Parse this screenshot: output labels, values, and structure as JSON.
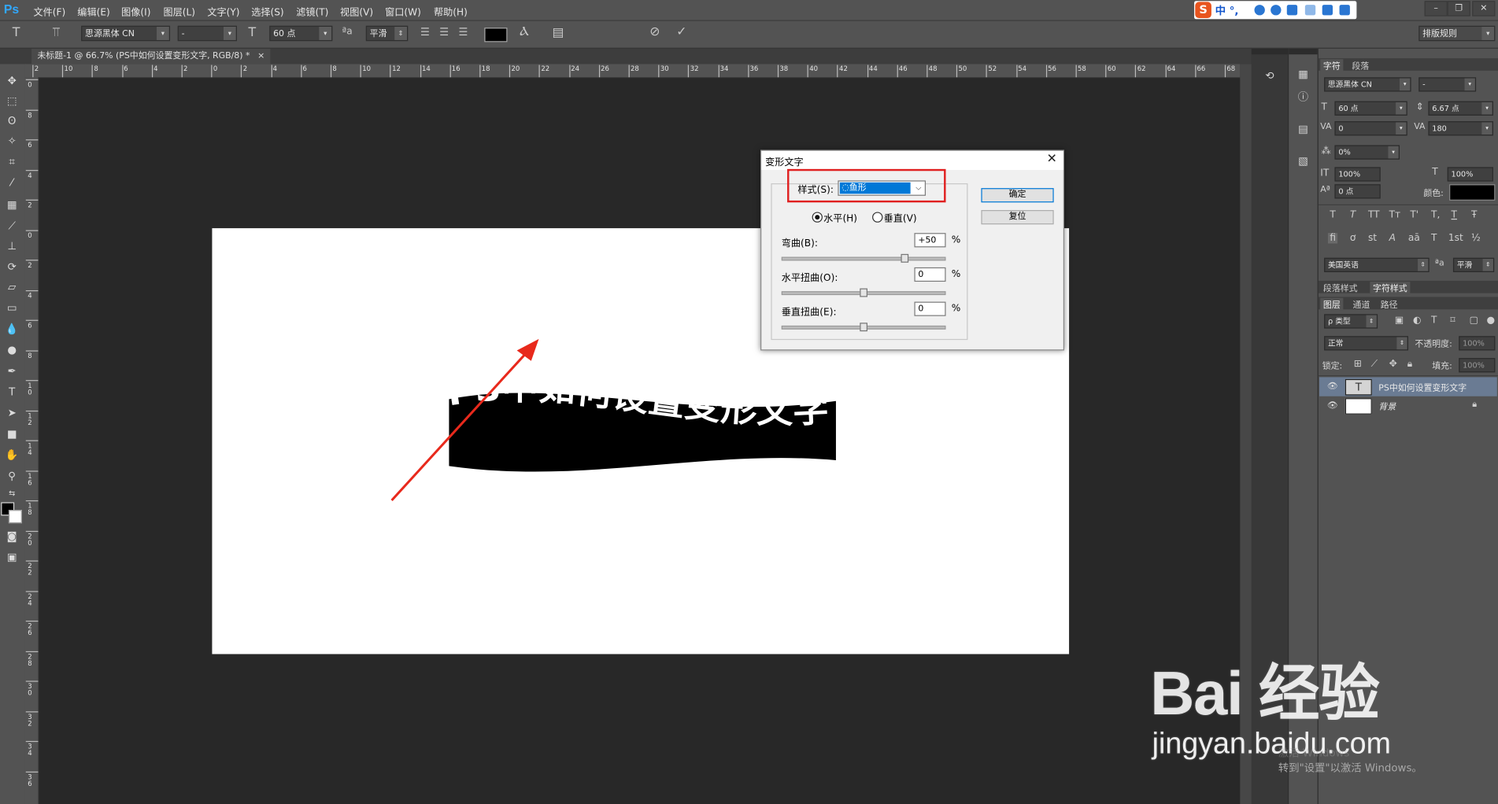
{
  "app": {
    "logo": "Ps"
  },
  "menu": {
    "items": [
      "文件(F)",
      "编辑(E)",
      "图像(I)",
      "图层(L)",
      "文字(Y)",
      "选择(S)",
      "滤镜(T)",
      "视图(V)",
      "窗口(W)",
      "帮助(H)"
    ]
  },
  "ime": {
    "logo": "S",
    "label": "中 °,"
  },
  "options": {
    "font_family": "思源黑体 CN",
    "font_style": "-",
    "font_size": "60 点",
    "antialias": "平滑",
    "text_color": "#000000",
    "workspace": "排版规则"
  },
  "document": {
    "tab_title": "未标题-1 @ 66.7% (PS中如何设置变形文字, RGB/8) *"
  },
  "rulers": {
    "top": [
      "2",
      "10",
      "8",
      "6",
      "4",
      "2",
      "0",
      "2",
      "4",
      "6",
      "8",
      "10",
      "12",
      "14",
      "16",
      "18",
      "20",
      "22",
      "24",
      "26",
      "28",
      "30",
      "32",
      "34",
      "36",
      "38",
      "40",
      "42",
      "44",
      "46",
      "48",
      "50",
      "52",
      "54",
      "56",
      "58",
      "60",
      "62",
      "64",
      "66",
      "68"
    ],
    "left": [
      "0",
      "8",
      "6",
      "4",
      "2",
      "0",
      "2",
      "4",
      "6",
      "8",
      "10",
      "12",
      "14",
      "16",
      "18",
      "20",
      "22",
      "24",
      "26",
      "28",
      "30",
      "32",
      "34",
      "36"
    ]
  },
  "canvas": {
    "warped_text": "PS中如何设置变形文字"
  },
  "dialog": {
    "title": "变形文字",
    "style_label": "样式(S):",
    "style_value": "鱼形",
    "horizontal": "水平(H)",
    "vertical": "垂直(V)",
    "orientation_selected": "horizontal",
    "bend_label": "弯曲(B):",
    "bend_value": "+50",
    "bend_level": 0.75,
    "hdistort_label": "水平扭曲(O):",
    "hdistort_value": "0",
    "hdistort_level": 0.5,
    "vdistort_label": "垂直扭曲(E):",
    "vdistort_value": "0",
    "vdistort_level": 0.5,
    "percent": "%",
    "ok": "确定",
    "reset": "复位"
  },
  "char_panel": {
    "tabs": [
      "字符",
      "段落"
    ],
    "font_family": "思源黑体 CN",
    "font_style": "-",
    "size": "60 点",
    "leading": "6.67 点",
    "kerning": "0",
    "tracking": "180",
    "scale_percent": "0%",
    "vscale": "100%",
    "hscale": "100%",
    "baseline": "0 点",
    "color_label": "颜色:",
    "color": "#000000",
    "language": "美国英语",
    "antialias": "平滑",
    "style_buttons": [
      "T",
      "T",
      "TT",
      "Tт",
      "T'",
      "T,",
      "T",
      "Ŧ"
    ],
    "opentype_buttons": [
      "fi",
      "ơ",
      "st",
      "A",
      "aā",
      "T",
      "1st",
      "½"
    ]
  },
  "styles_tabs": [
    "段落样式",
    "字符样式"
  ],
  "layers_panel": {
    "tabs": [
      "图层",
      "通道",
      "路径"
    ],
    "filter": "ρ 类型",
    "blend_mode": "正常",
    "opacity_label": "不透明度:",
    "opacity": "100%",
    "lock_label": "锁定:",
    "fill_label": "填充:",
    "fill": "100%",
    "layers": [
      {
        "name": "PS中如何设置变形文字",
        "type": "text",
        "selected": true
      },
      {
        "name": "背景",
        "type": "background",
        "locked": true
      }
    ]
  },
  "watermark": {
    "logo": "Bai 经验",
    "url": "jingyan.baidu.com"
  },
  "activation": {
    "line1": "激活 Windows",
    "line2": "转到\"设置\"以激活 Windows。"
  }
}
